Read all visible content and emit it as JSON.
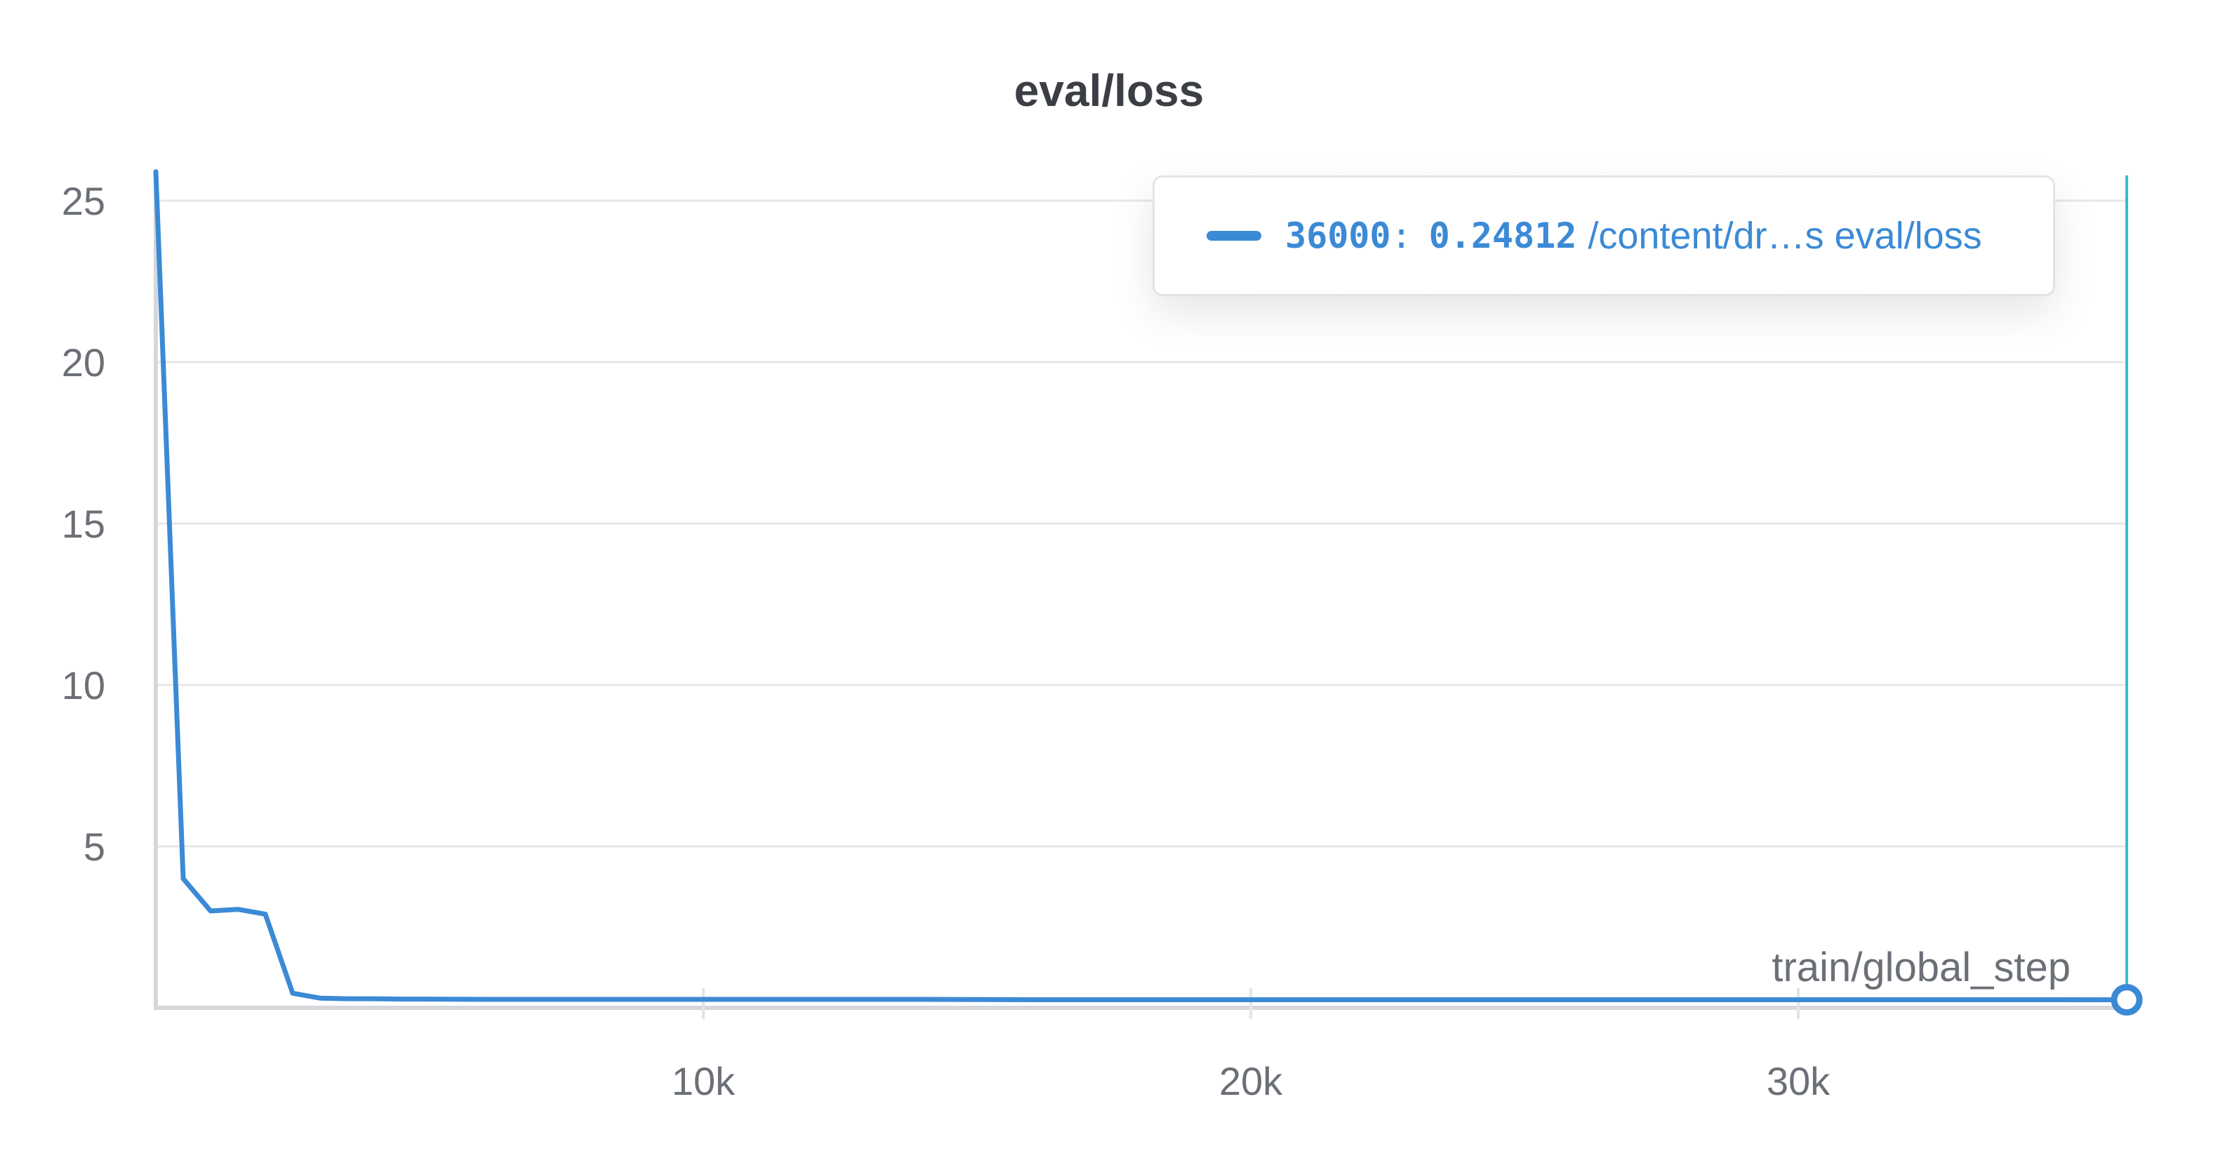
{
  "chart_data": {
    "type": "line",
    "title": "eval/loss",
    "xlabel": "train/global_step",
    "ylabel": "",
    "xlim": [
      0,
      36000
    ],
    "ylim": [
      0,
      26
    ],
    "yticks": [
      {
        "value": 5,
        "label": "5"
      },
      {
        "value": 10,
        "label": "10"
      },
      {
        "value": 15,
        "label": "15"
      },
      {
        "value": 20,
        "label": "20"
      },
      {
        "value": 25,
        "label": "25"
      }
    ],
    "xticks": [
      {
        "value": 10000,
        "label": "10k"
      },
      {
        "value": 20000,
        "label": "20k"
      },
      {
        "value": 30000,
        "label": "30k"
      }
    ],
    "grid": true,
    "series": [
      {
        "color": "#3b8ad6",
        "x": [
          0,
          500,
          1000,
          1500,
          2000,
          2500,
          3000,
          3500,
          4000,
          4500,
          5000,
          6000,
          7000,
          8000,
          9000,
          10000,
          12000,
          14000,
          16000,
          18000,
          20000,
          22000,
          24000,
          26000,
          28000,
          30000,
          32000,
          34000,
          36000
        ],
        "y": [
          25.9,
          4.0,
          3.0,
          3.05,
          2.9,
          0.45,
          0.3,
          0.28,
          0.28,
          0.27,
          0.27,
          0.26,
          0.26,
          0.26,
          0.26,
          0.26,
          0.26,
          0.26,
          0.25,
          0.25,
          0.25,
          0.25,
          0.25,
          0.25,
          0.25,
          0.25,
          0.25,
          0.25,
          0.24812
        ]
      }
    ],
    "hover": {
      "x": 36000,
      "step_label": "36000",
      "value_label": "0.24812",
      "separator": ":",
      "run_label": "/content/dr…s eval/loss",
      "cursor_color": "#3fb8cc"
    }
  }
}
